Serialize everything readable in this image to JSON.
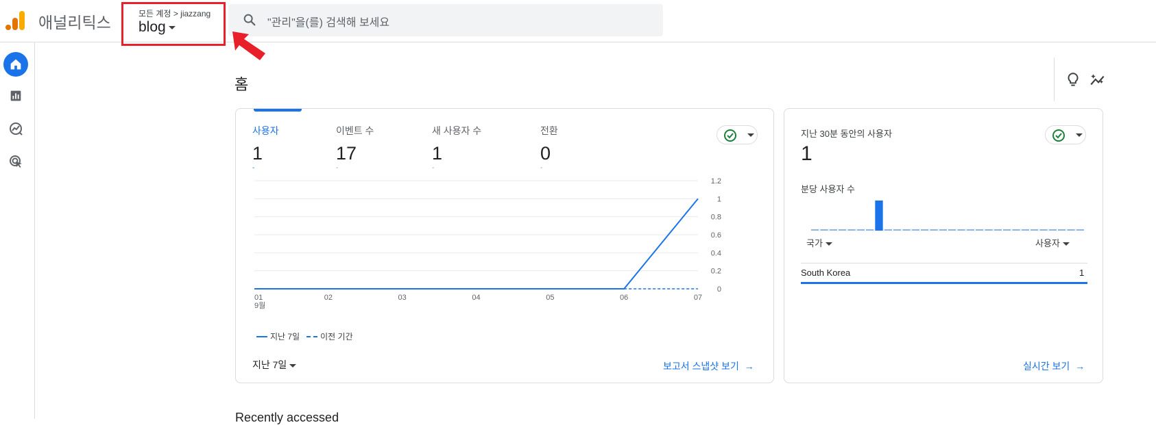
{
  "header": {
    "app_name": "애널리틱스",
    "account_path": "모든 계정 > jiazzang",
    "property": "blog",
    "search_placeholder": "\"관리\"을(를) 검색해 보세요"
  },
  "page": {
    "title": "홈",
    "recent_heading": "Recently accessed"
  },
  "metrics": [
    {
      "label": "사용자",
      "value": "1",
      "delta": "-",
      "active": true
    },
    {
      "label": "이벤트 수",
      "value": "17",
      "delta": "-",
      "active": false
    },
    {
      "label": "새 사용자 수",
      "value": "1",
      "delta": "-",
      "active": false
    },
    {
      "label": "전환",
      "value": "0",
      "delta": "-",
      "active": false
    }
  ],
  "main_card": {
    "date_range": "지난 7일",
    "report_link": "보고서 스냅샷 보기",
    "legend": [
      "지난 7일",
      "이전 기간"
    ]
  },
  "chart_data": {
    "type": "line",
    "x": [
      "01",
      "02",
      "03",
      "04",
      "05",
      "06",
      "07"
    ],
    "x_month": "9월",
    "series": [
      {
        "name": "지난 7일",
        "values": [
          0,
          0,
          0,
          0,
          0,
          0,
          1
        ],
        "style": "solid"
      },
      {
        "name": "이전 기간",
        "values": [
          null,
          null,
          null,
          null,
          null,
          0,
          0
        ],
        "style": "dashed"
      }
    ],
    "yticks": [
      "0",
      "0.2",
      "0.4",
      "0.6",
      "0.8",
      "1",
      "1.2"
    ],
    "ylim": [
      0,
      1.2
    ],
    "grid": true,
    "color": "#1a73e8"
  },
  "realtime": {
    "label": "지난 30분 동안의 사용자",
    "value": "1",
    "per_minute_label": "분당 사용자 수",
    "per_minute_values": [
      0,
      0,
      0,
      0,
      0,
      0,
      0,
      1,
      0,
      0,
      0,
      0,
      0,
      0,
      0,
      0,
      0,
      0,
      0,
      0,
      0,
      0,
      0,
      0,
      0,
      0,
      0,
      0,
      0,
      0
    ],
    "col_country": "국가",
    "col_users": "사용자",
    "rows": [
      {
        "country": "South Korea",
        "users": "1"
      }
    ],
    "link": "실시간 보기"
  },
  "colors": {
    "accent": "#1a73e8",
    "highlight": "#e8202a"
  }
}
